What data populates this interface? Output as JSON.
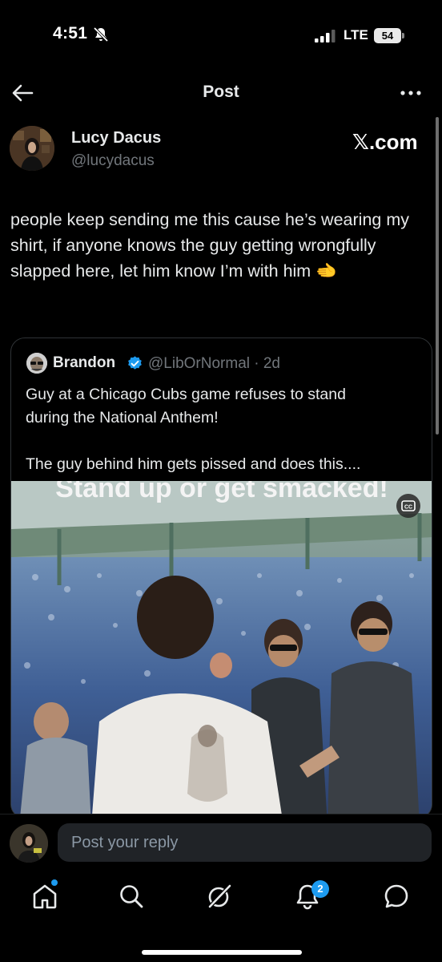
{
  "status": {
    "time": "4:51",
    "network": "LTE",
    "battery": "54"
  },
  "header": {
    "title": "Post"
  },
  "author": {
    "name": "Lucy Dacus",
    "handle": "@lucydacus",
    "source_label": "𝕏.com"
  },
  "post": {
    "text": "people keep sending me this cause he’s wearing my shirt, if anyone knows the guy getting wrongfully slapped here, let him know I’m with him 🫲"
  },
  "quote": {
    "name": "Brandon",
    "handle_time": "@LibOrNormal · 2d",
    "text_line1": "Guy at a Chicago Cubs game refuses to stand",
    "text_line2": "during the National Anthem!",
    "text_line3": "The guy behind him gets pissed and does this....",
    "video_caption": "Stand up or get smacked!",
    "cc_label": "CC"
  },
  "reply": {
    "placeholder": "Post your reply"
  },
  "tabbar": {
    "notifications_count": "2"
  },
  "colors": {
    "background": "#000000",
    "accent": "#1d9bf0",
    "secondary_text": "#71767b",
    "border": "#2f3336"
  },
  "icons": [
    "bell-slash-icon",
    "signal-icon",
    "battery-icon",
    "back-arrow-icon",
    "more-icon",
    "verified-badge-icon",
    "cc-icon",
    "home-icon",
    "search-icon",
    "grok-icon",
    "notifications-icon",
    "messages-icon"
  ]
}
